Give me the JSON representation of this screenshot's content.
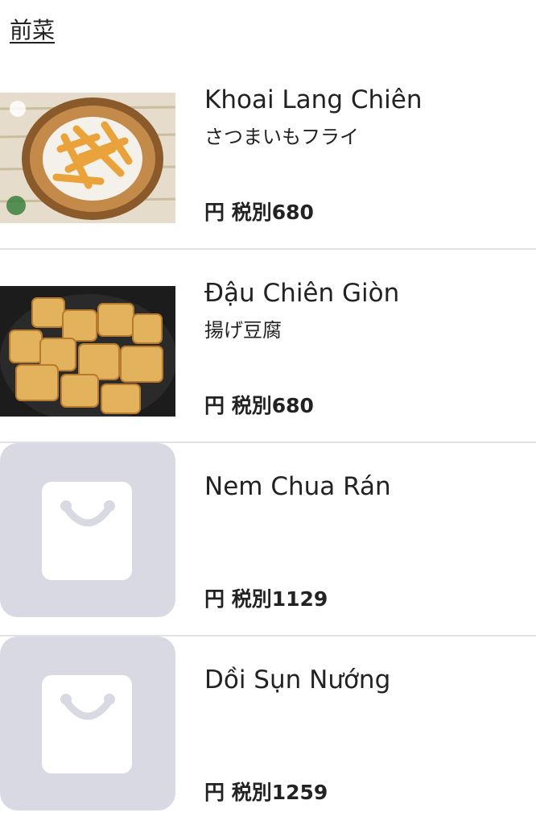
{
  "section": {
    "title": "前菜"
  },
  "items": [
    {
      "name": "Khoai Lang Chiên",
      "subtitle": "さつまいもフライ",
      "price": "円 税別680",
      "image": "fries-photo"
    },
    {
      "name": "Đậu Chiên Giòn",
      "subtitle": "揚げ豆腐",
      "price": "円 税別680",
      "image": "fried-tofu-photo"
    },
    {
      "name": "Nem Chua Rán",
      "subtitle": "",
      "price": "円 税別1129",
      "image": "shopping-bag-placeholder-icon"
    },
    {
      "name": "Dồi Sụn Nướng",
      "subtitle": "",
      "price": "円 税別1259",
      "image": "shopping-bag-placeholder-icon"
    }
  ],
  "colors": {
    "placeholder_bg": "#d9d9e4",
    "divider": "#e2e2e2",
    "text": "#222222"
  }
}
